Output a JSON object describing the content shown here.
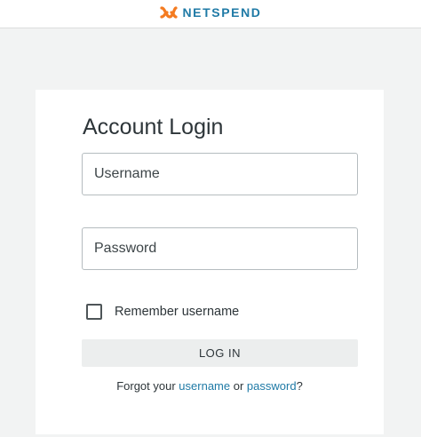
{
  "header": {
    "brand_name": "NETSPEND",
    "logo_icon": "netspend-logo-icon",
    "brand_color": "#1f7aa6",
    "mark_color": "#f47b20"
  },
  "login": {
    "title": "Account Login",
    "username_placeholder": "Username",
    "password_placeholder": "Password",
    "remember_label": "Remember username",
    "remember_checked": false,
    "login_button": "LOG IN",
    "forgot_prefix": "Forgot your",
    "forgot_username": "username",
    "forgot_or": "or",
    "forgot_password": "password",
    "forgot_suffix": "?"
  }
}
